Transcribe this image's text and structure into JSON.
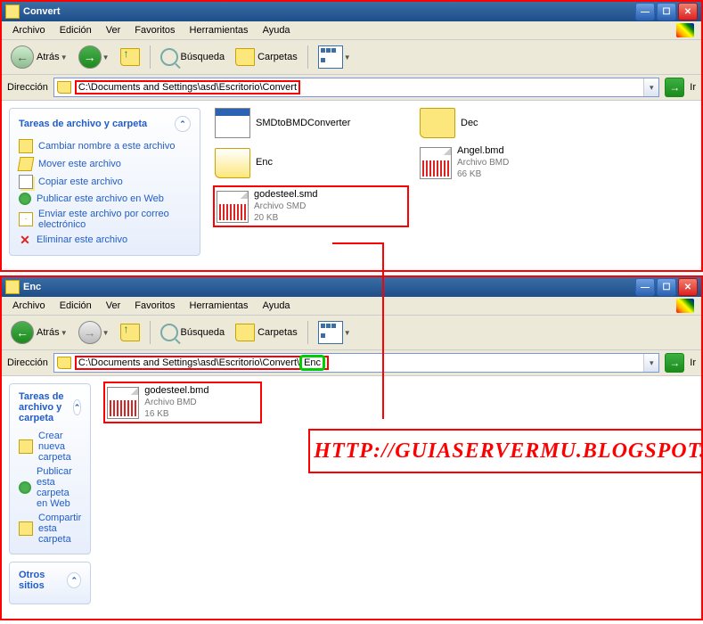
{
  "window1": {
    "title": "Convert",
    "menu": {
      "archivo": "Archivo",
      "edicion": "Edición",
      "ver": "Ver",
      "favoritos": "Favoritos",
      "herramientas": "Herramientas",
      "ayuda": "Ayuda"
    },
    "toolbar": {
      "atras": "Atrás",
      "busqueda": "Búsqueda",
      "carpetas": "Carpetas"
    },
    "addr": {
      "label": "Dirección",
      "path": "C:\\Documents and Settings\\asd\\Escritorio\\Convert",
      "ir": "Ir"
    },
    "sidepane": {
      "title": "Tareas de archivo y carpeta",
      "rename": "Cambiar nombre a este archivo",
      "move": "Mover este archivo",
      "copy": "Copiar este archivo",
      "publish": "Publicar este archivo en Web",
      "email": "Enviar este archivo por correo electrónico",
      "delete": "Eliminar este archivo"
    },
    "items": {
      "smdconv": "SMDtoBMDConverter",
      "dec": "Dec",
      "enc": "Enc",
      "angel": {
        "name": "Angel.bmd",
        "type": "Archivo BMD",
        "size": "66 KB"
      },
      "gode": {
        "name": "godesteel.smd",
        "type": "Archivo SMD",
        "size": "20 KB"
      }
    }
  },
  "window2": {
    "title": "Enc",
    "menu": {
      "archivo": "Archivo",
      "edicion": "Edición",
      "ver": "Ver",
      "favoritos": "Favoritos",
      "herramientas": "Herramientas",
      "ayuda": "Ayuda"
    },
    "toolbar": {
      "atras": "Atrás",
      "busqueda": "Búsqueda",
      "carpetas": "Carpetas"
    },
    "addr": {
      "label": "Dirección",
      "path_prefix": "C:\\Documents and Settings\\asd\\Escritorio\\Convert\\",
      "path_hl": "Enc",
      "ir": "Ir"
    },
    "sidepane": {
      "title": "Tareas de archivo y carpeta",
      "new": "Crear nueva carpeta",
      "publish": "Publicar esta carpeta en Web",
      "share": "Compartir esta carpeta",
      "other": "Otros sitios"
    },
    "items": {
      "gode": {
        "name": "godesteel.bmd",
        "type": "Archivo BMD",
        "size": "16 KB"
      }
    }
  },
  "watermark": "HTTP://GUIASERVERMU.BLOGSPOT.COM"
}
